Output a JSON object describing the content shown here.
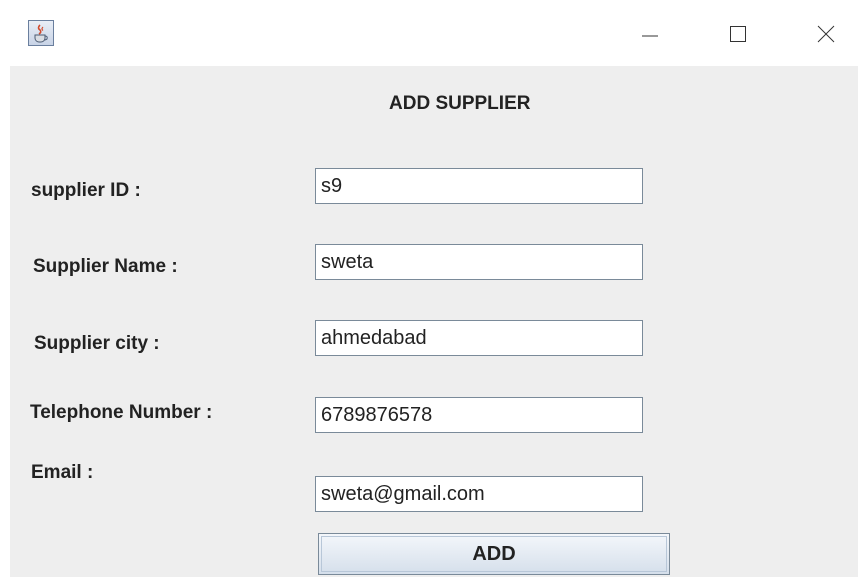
{
  "window": {
    "icons": {
      "app": "java-cup-icon",
      "minimize": "minimize-icon",
      "maximize": "maximize-icon",
      "close": "close-icon"
    }
  },
  "form": {
    "heading": "ADD SUPPLIER",
    "fields": [
      {
        "label": "supplier ID :",
        "value": "s9"
      },
      {
        "label": "Supplier Name :",
        "value": "sweta"
      },
      {
        "label": "Supplier city :",
        "value": "ahmedabad"
      },
      {
        "label": "Telephone Number :",
        "value": "6789876578"
      },
      {
        "label": "Email :",
        "value": "sweta@gmail.com"
      }
    ],
    "submit_label": "ADD"
  }
}
